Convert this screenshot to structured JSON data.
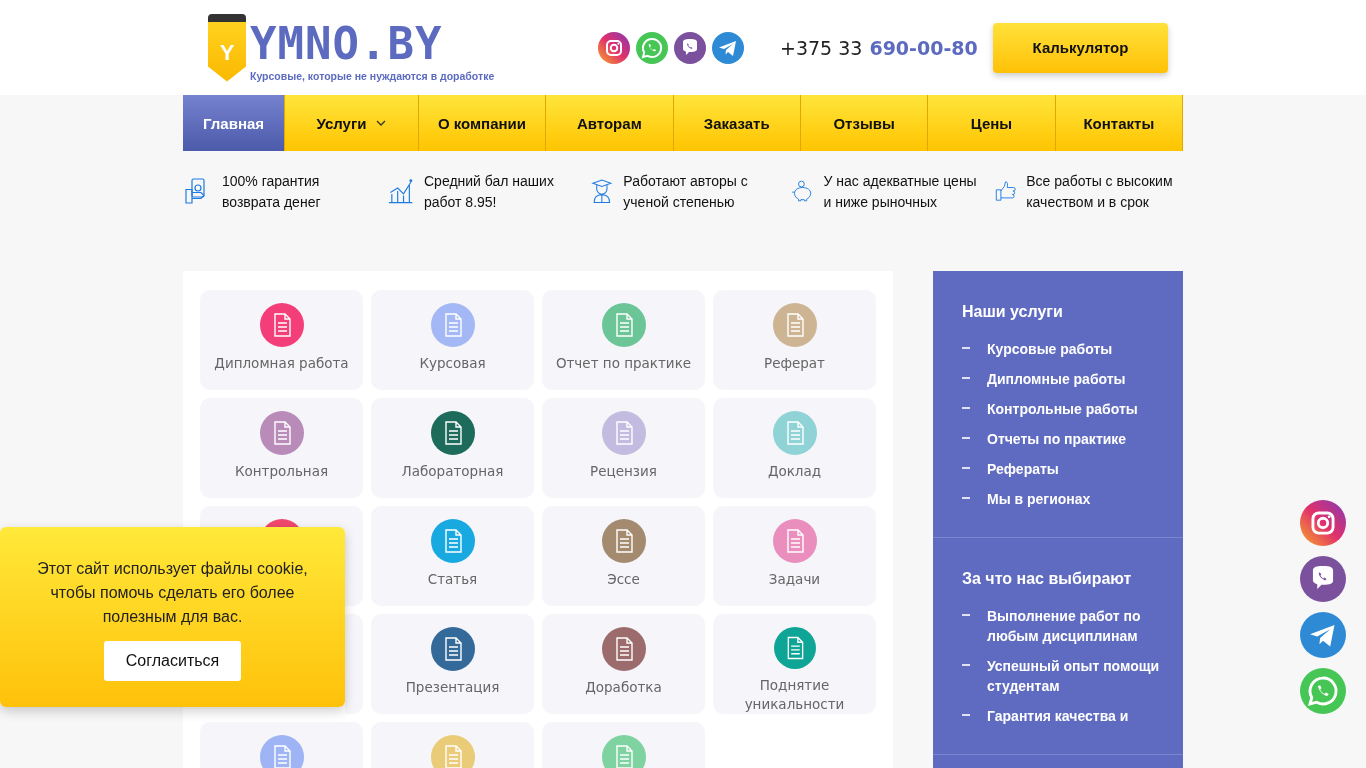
{
  "logo": {
    "badge": "Y",
    "name": "YMNO.BY",
    "tagline": "Курсовые, которые не нуждаются в доработке"
  },
  "phone": {
    "prefix": "+375 33",
    "number": "690-00-80"
  },
  "calculator_button": "Калькулятор",
  "nav": [
    {
      "label": "Главная",
      "selected": true,
      "dropdown": false
    },
    {
      "label": "Услуги",
      "selected": false,
      "dropdown": true
    },
    {
      "label": "О компании",
      "selected": false,
      "dropdown": false
    },
    {
      "label": "Авторам",
      "selected": false,
      "dropdown": false
    },
    {
      "label": "Заказать",
      "selected": false,
      "dropdown": false
    },
    {
      "label": "Отзывы",
      "selected": false,
      "dropdown": false
    },
    {
      "label": "Цены",
      "selected": false,
      "dropdown": false
    },
    {
      "label": "Контакты",
      "selected": false,
      "dropdown": false
    }
  ],
  "features": [
    {
      "kind": "money",
      "text": "100% гарантия возврата денег"
    },
    {
      "kind": "chart",
      "text": "Средний бал наших работ 8.95!"
    },
    {
      "kind": "graduate",
      "text": "Работают авторы с ученой степенью"
    },
    {
      "kind": "piggy",
      "text": "У нас адекватные цены и ниже рыночных"
    },
    {
      "kind": "thumb",
      "text": "Все работы с высоким качеством и в срок"
    }
  ],
  "tiles": [
    {
      "label": "Дипломная работа",
      "color": "#f33e7a"
    },
    {
      "label": "Курсовая",
      "color": "#a3b8f5"
    },
    {
      "label": "Отчет по практике",
      "color": "#6cc597"
    },
    {
      "label": "Реферат",
      "color": "#cdb593"
    },
    {
      "label": "Контрольная",
      "color": "#b88bb8"
    },
    {
      "label": "Лабораторная",
      "color": "#1d6b5b"
    },
    {
      "label": "Рецензия",
      "color": "#c3bbe0"
    },
    {
      "label": "Доклад",
      "color": "#8fd3d6"
    },
    {
      "color": "#f0486e"
    },
    {
      "label": "Статья",
      "color": "#18a9e0"
    },
    {
      "label": "Эссе",
      "color": "#a48b6f"
    },
    {
      "label": "Задачи",
      "color": "#ea8fbd"
    },
    {
      "kind": "covered"
    },
    {
      "label": "Презентация",
      "color": "#346a9a"
    },
    {
      "label": "Доработка",
      "color": "#9c6b6b"
    },
    {
      "label": "Поднятие уникальности",
      "color": "#0fa596"
    },
    {
      "color": "#9fb4f5"
    },
    {
      "color": "#eacb78"
    },
    {
      "color": "#7fd3a0"
    }
  ],
  "sidebar": [
    {
      "title": "Наши услуги",
      "items": [
        "Курсовые работы",
        "Дипломные работы",
        "Контрольные работы",
        "Отчеты по практике",
        "Рефераты",
        "Мы в регионах"
      ]
    },
    {
      "title": "За что нас выбирают",
      "items": [
        "Выполнение работ по любым дисциплинам",
        "Успешный опыт помощи студентам",
        "Гарантия качества и"
      ]
    }
  ],
  "cookie": {
    "text": "Этот сайт использует файлы cookie, чтобы помочь сделать его более полезным для вас.",
    "button": "Согласиться"
  },
  "floating": [
    {
      "kind": "instagram"
    },
    {
      "kind": "viber"
    },
    {
      "kind": "telegram"
    },
    {
      "kind": "whatsapp"
    }
  ]
}
